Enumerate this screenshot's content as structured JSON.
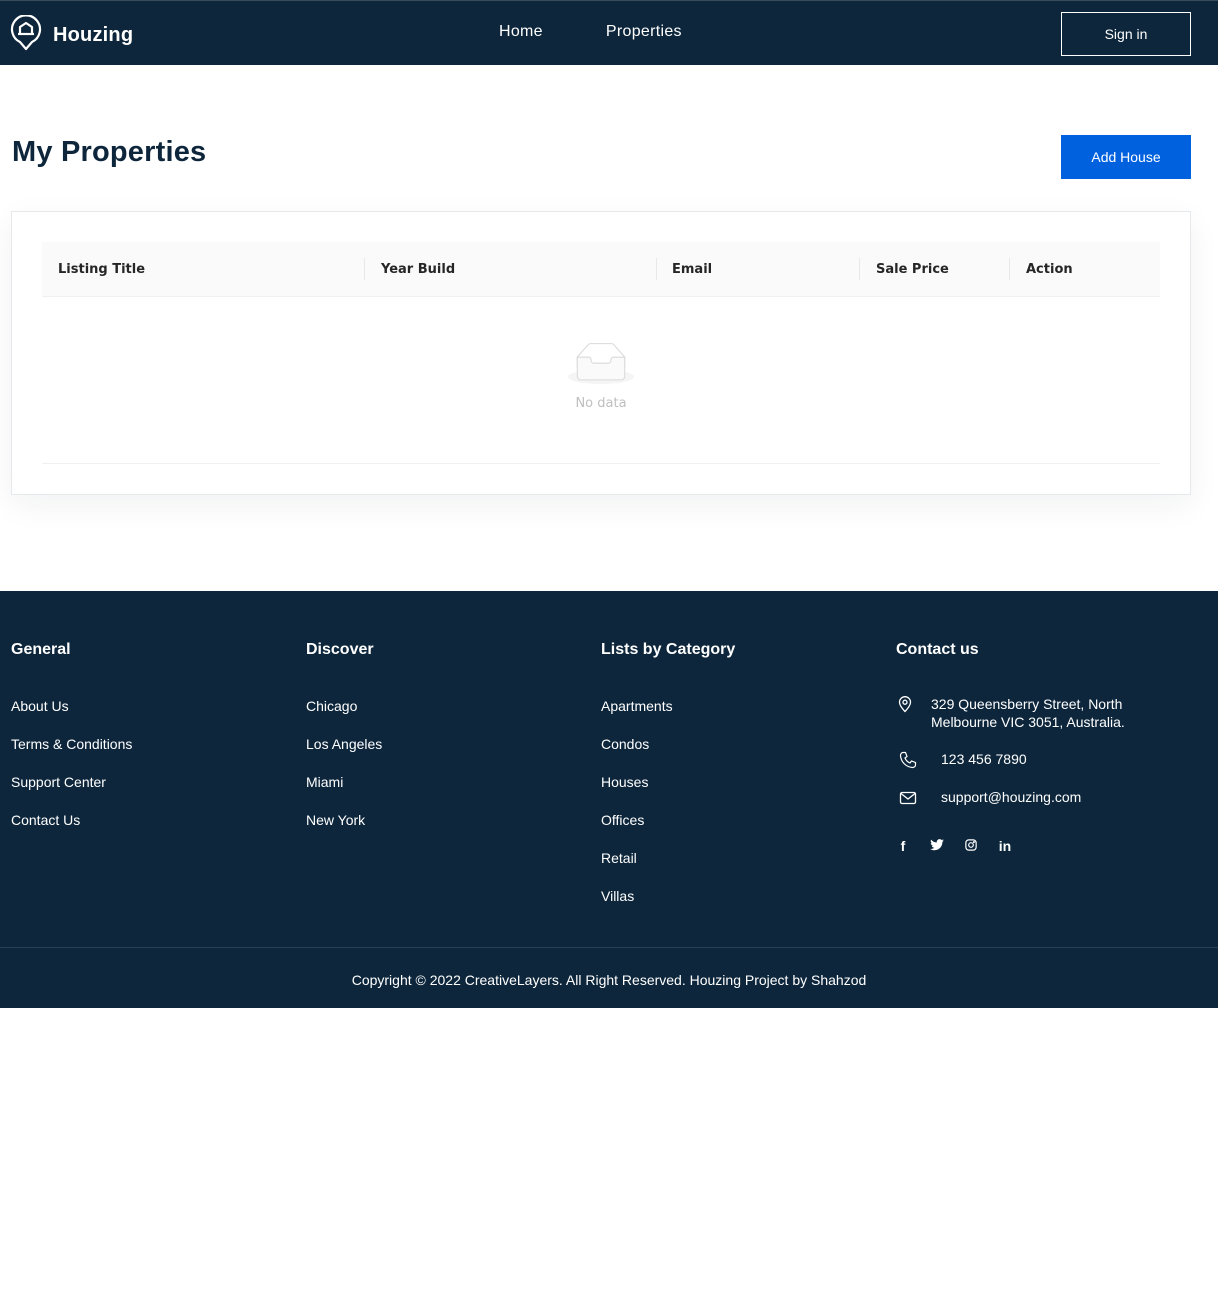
{
  "navbar": {
    "brand": "Houzing",
    "links": [
      "Home",
      "Properties"
    ],
    "signin_label": "Sign in"
  },
  "main": {
    "title": "My Properties",
    "add_button": "Add House",
    "table": {
      "columns": [
        "Listing Title",
        "Year Build",
        "Email",
        "Sale Price",
        "Action"
      ],
      "rows": [],
      "empty_text": "No data"
    }
  },
  "footer": {
    "general": {
      "heading": "General",
      "links": [
        "About Us",
        "Terms & Conditions",
        "Support Center",
        "Contact Us"
      ]
    },
    "discover": {
      "heading": "Discover",
      "links": [
        "Chicago",
        "Los Angeles",
        "Miami",
        "New York"
      ]
    },
    "category": {
      "heading": "Lists by Category",
      "links": [
        "Apartments",
        "Condos",
        "Houses",
        "Offices",
        "Retail",
        "Villas"
      ]
    },
    "contact": {
      "heading": "Contact us",
      "address_line1": "329 Queensberry Street, North",
      "address_line2": "Melbourne VIC 3051, Australia.",
      "phone": "123 456 7890",
      "email": "support@houzing.com",
      "social": [
        "facebook-icon",
        "twitter-icon",
        "instagram-icon",
        "linkedin-icon"
      ]
    },
    "copyright": "Copyright © 2022 CreativeLayers. All Right Reserved. Houzing Project by Shahzod"
  },
  "colors": {
    "navy": "#0d263b",
    "primary_blue": "#0061df"
  }
}
